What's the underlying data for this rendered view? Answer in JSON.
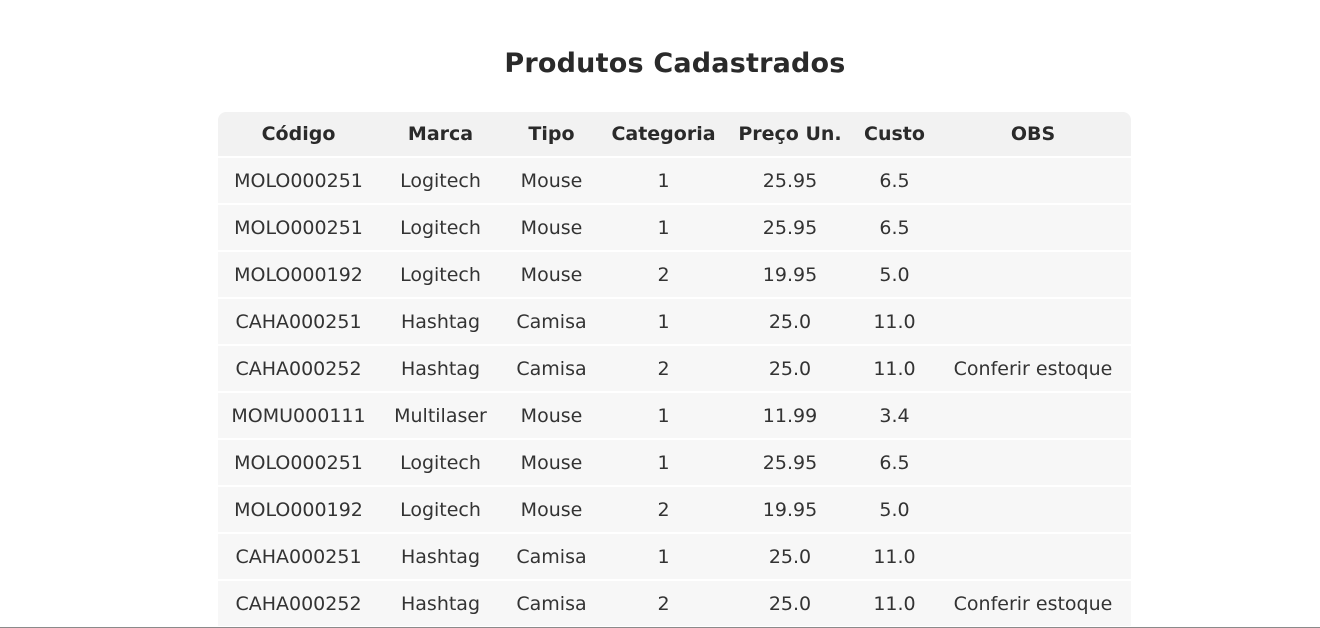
{
  "page": {
    "title": "Produtos Cadastrados"
  },
  "table": {
    "headers": [
      "Código",
      "Marca",
      "Tipo",
      "Categoria",
      "Preço Un.",
      "Custo",
      "OBS"
    ],
    "rows": [
      [
        "MOLO000251",
        "Logitech",
        "Mouse",
        "1",
        "25.95",
        "6.5",
        ""
      ],
      [
        "MOLO000251",
        "Logitech",
        "Mouse",
        "1",
        "25.95",
        "6.5",
        ""
      ],
      [
        "MOLO000192",
        "Logitech",
        "Mouse",
        "2",
        "19.95",
        "5.0",
        ""
      ],
      [
        "CAHA000251",
        "Hashtag",
        "Camisa",
        "1",
        "25.0",
        "11.0",
        ""
      ],
      [
        "CAHA000252",
        "Hashtag",
        "Camisa",
        "2",
        "25.0",
        "11.0",
        "Conferir estoque"
      ],
      [
        "MOMU000111",
        "Multilaser",
        "Mouse",
        "1",
        "11.99",
        "3.4",
        ""
      ],
      [
        "MOLO000251",
        "Logitech",
        "Mouse",
        "1",
        "25.95",
        "6.5",
        ""
      ],
      [
        "MOLO000192",
        "Logitech",
        "Mouse",
        "2",
        "19.95",
        "5.0",
        ""
      ],
      [
        "CAHA000251",
        "Hashtag",
        "Camisa",
        "1",
        "25.0",
        "11.0",
        ""
      ],
      [
        "CAHA000252",
        "Hashtag",
        "Camisa",
        "2",
        "25.0",
        "11.0",
        "Conferir estoque"
      ]
    ]
  }
}
